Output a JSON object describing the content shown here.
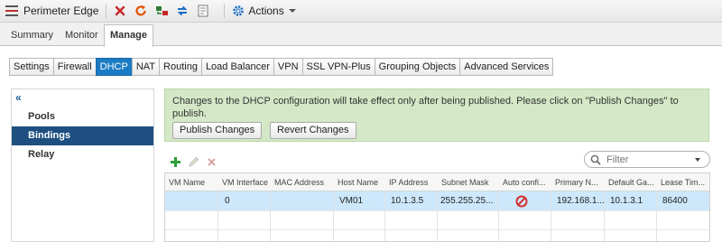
{
  "titlebar": {
    "title": "Perimeter Edge",
    "actions_label": "Actions",
    "icons": [
      "close-icon",
      "refresh-icon",
      "deploy-icon",
      "sync-icon",
      "document-icon",
      "gear-icon"
    ]
  },
  "main_tabs": [
    {
      "label": "Summary"
    },
    {
      "label": "Monitor"
    },
    {
      "label": "Manage",
      "active": true
    }
  ],
  "sub_tabs": [
    {
      "label": "Settings"
    },
    {
      "label": "Firewall"
    },
    {
      "label": "DHCP",
      "active": true
    },
    {
      "label": "NAT"
    },
    {
      "label": "Routing"
    },
    {
      "label": "Load Balancer"
    },
    {
      "label": "VPN"
    },
    {
      "label": "SSL VPN-Plus"
    },
    {
      "label": "Grouping Objects"
    },
    {
      "label": "Advanced Services"
    }
  ],
  "sidebar": {
    "collapse_glyph": "«",
    "items": [
      {
        "label": "Pools"
      },
      {
        "label": "Bindings",
        "active": true
      },
      {
        "label": "Relay"
      }
    ]
  },
  "banner": {
    "message": "Changes to the DHCP configuration will take effect only after being published. Please click on \"Publish Changes\" to publish.",
    "publish_label": "Publish Changes",
    "revert_label": "Revert Changes",
    "background": "#d4e8c7"
  },
  "toolbar": {
    "icons": [
      "add-icon",
      "edit-icon",
      "delete-icon"
    ]
  },
  "filter": {
    "placeholder": "Filter"
  },
  "table": {
    "columns": [
      "VM Name",
      "VM Interface",
      "MAC Address",
      "Host Name",
      "IP Address",
      "Subnet Mask",
      "Auto confi...",
      "Primary N...",
      "Default Ga...",
      "Lease Tim..."
    ],
    "rows": [
      {
        "vm_name": "",
        "vm_interface": "0",
        "mac_address": "",
        "host_name": "VM01",
        "ip_address": "10.1.3.5",
        "subnet_mask": "255.255.25...",
        "auto_config_icon": "no-icon",
        "primary_ns": "192.168.1....",
        "default_gateway": "10.1.3.1",
        "lease_time": "86400"
      }
    ],
    "selected_row_color": "#cde8fb"
  },
  "colors": {
    "accent": "#1b7bc4",
    "sidebar_active": "#1d4f80"
  }
}
